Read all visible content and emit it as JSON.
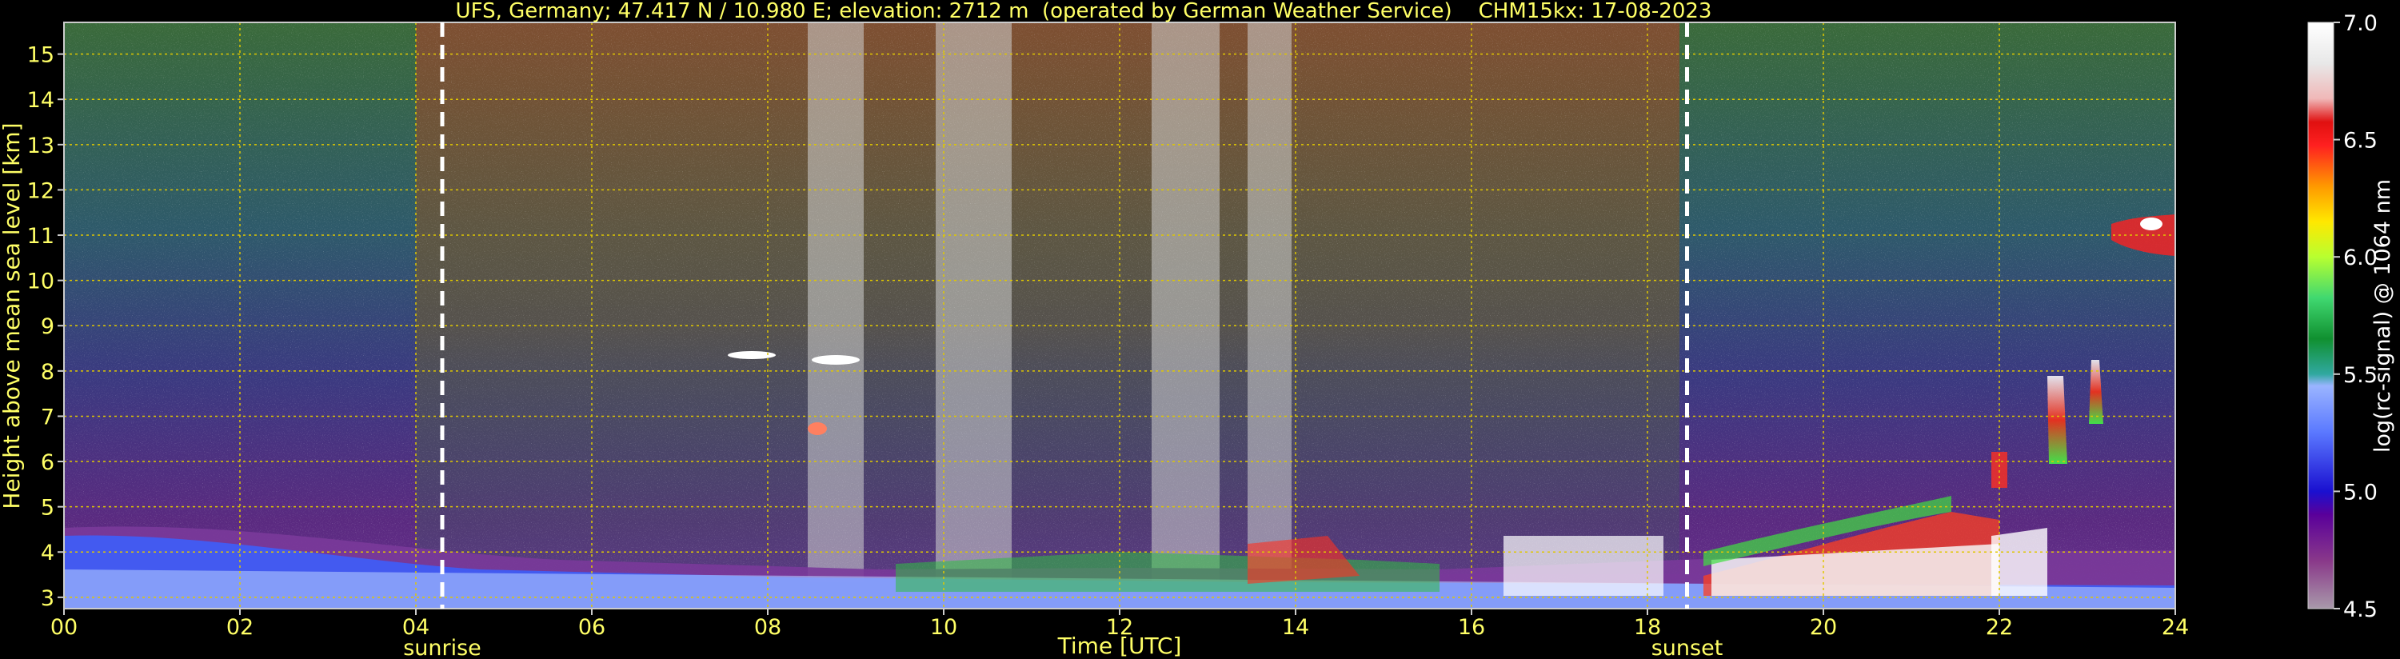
{
  "chart_data": {
    "type": "heatmap",
    "title": "UFS, Germany; 47.417 N / 10.980 E; elevation: 2712 m  (operated by German Weather Service)    CHM15kx: 17-08-2023",
    "xlabel": "Time [UTC]",
    "ylabel": "Height above mean sea level [km]",
    "xlim": [
      0,
      24
    ],
    "ylim": [
      2.75,
      15.7
    ],
    "x_ticks": [
      "00",
      "02",
      "04",
      "06",
      "08",
      "10",
      "12",
      "14",
      "16",
      "18",
      "20",
      "22",
      "24"
    ],
    "y_ticks": [
      "3",
      "4",
      "5",
      "6",
      "7",
      "8",
      "9",
      "10",
      "11",
      "12",
      "13",
      "14",
      "15"
    ],
    "grid": true,
    "markers": [
      {
        "label": "sunrise",
        "x": 4.3
      },
      {
        "label": "sunset",
        "x": 18.45
      }
    ],
    "colorbar": {
      "label": "log(rc-signal) @ 1064 nm",
      "ticks": [
        "4.5",
        "5.0",
        "5.5",
        "6.0",
        "6.5",
        "7.0"
      ],
      "min": 4.5,
      "max": 7.0
    }
  },
  "colors": {
    "background": "#000000",
    "text": "#ffff66",
    "grid": "#e0c800",
    "marker_line": "#ffffff",
    "colorbar_text": "#ffffff"
  }
}
